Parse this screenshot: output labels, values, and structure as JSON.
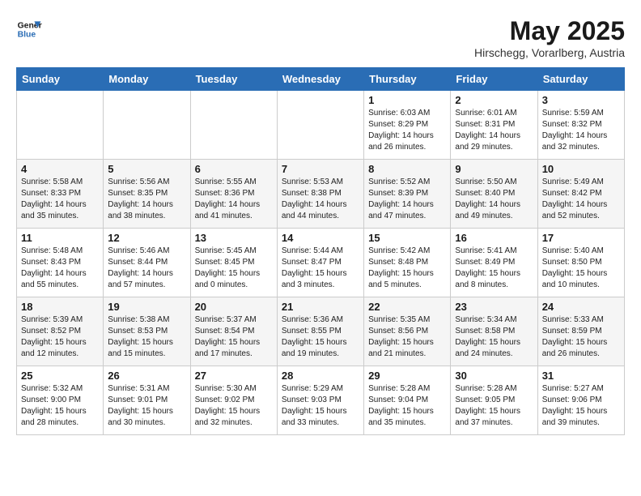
{
  "header": {
    "logo_line1": "General",
    "logo_line2": "Blue",
    "month_year": "May 2025",
    "location": "Hirschegg, Vorarlberg, Austria"
  },
  "days_of_week": [
    "Sunday",
    "Monday",
    "Tuesday",
    "Wednesday",
    "Thursday",
    "Friday",
    "Saturday"
  ],
  "weeks": [
    [
      {
        "day": "",
        "info": ""
      },
      {
        "day": "",
        "info": ""
      },
      {
        "day": "",
        "info": ""
      },
      {
        "day": "",
        "info": ""
      },
      {
        "day": "1",
        "info": "Sunrise: 6:03 AM\nSunset: 8:29 PM\nDaylight: 14 hours\nand 26 minutes."
      },
      {
        "day": "2",
        "info": "Sunrise: 6:01 AM\nSunset: 8:31 PM\nDaylight: 14 hours\nand 29 minutes."
      },
      {
        "day": "3",
        "info": "Sunrise: 5:59 AM\nSunset: 8:32 PM\nDaylight: 14 hours\nand 32 minutes."
      }
    ],
    [
      {
        "day": "4",
        "info": "Sunrise: 5:58 AM\nSunset: 8:33 PM\nDaylight: 14 hours\nand 35 minutes."
      },
      {
        "day": "5",
        "info": "Sunrise: 5:56 AM\nSunset: 8:35 PM\nDaylight: 14 hours\nand 38 minutes."
      },
      {
        "day": "6",
        "info": "Sunrise: 5:55 AM\nSunset: 8:36 PM\nDaylight: 14 hours\nand 41 minutes."
      },
      {
        "day": "7",
        "info": "Sunrise: 5:53 AM\nSunset: 8:38 PM\nDaylight: 14 hours\nand 44 minutes."
      },
      {
        "day": "8",
        "info": "Sunrise: 5:52 AM\nSunset: 8:39 PM\nDaylight: 14 hours\nand 47 minutes."
      },
      {
        "day": "9",
        "info": "Sunrise: 5:50 AM\nSunset: 8:40 PM\nDaylight: 14 hours\nand 49 minutes."
      },
      {
        "day": "10",
        "info": "Sunrise: 5:49 AM\nSunset: 8:42 PM\nDaylight: 14 hours\nand 52 minutes."
      }
    ],
    [
      {
        "day": "11",
        "info": "Sunrise: 5:48 AM\nSunset: 8:43 PM\nDaylight: 14 hours\nand 55 minutes."
      },
      {
        "day": "12",
        "info": "Sunrise: 5:46 AM\nSunset: 8:44 PM\nDaylight: 14 hours\nand 57 minutes."
      },
      {
        "day": "13",
        "info": "Sunrise: 5:45 AM\nSunset: 8:45 PM\nDaylight: 15 hours\nand 0 minutes."
      },
      {
        "day": "14",
        "info": "Sunrise: 5:44 AM\nSunset: 8:47 PM\nDaylight: 15 hours\nand 3 minutes."
      },
      {
        "day": "15",
        "info": "Sunrise: 5:42 AM\nSunset: 8:48 PM\nDaylight: 15 hours\nand 5 minutes."
      },
      {
        "day": "16",
        "info": "Sunrise: 5:41 AM\nSunset: 8:49 PM\nDaylight: 15 hours\nand 8 minutes."
      },
      {
        "day": "17",
        "info": "Sunrise: 5:40 AM\nSunset: 8:50 PM\nDaylight: 15 hours\nand 10 minutes."
      }
    ],
    [
      {
        "day": "18",
        "info": "Sunrise: 5:39 AM\nSunset: 8:52 PM\nDaylight: 15 hours\nand 12 minutes."
      },
      {
        "day": "19",
        "info": "Sunrise: 5:38 AM\nSunset: 8:53 PM\nDaylight: 15 hours\nand 15 minutes."
      },
      {
        "day": "20",
        "info": "Sunrise: 5:37 AM\nSunset: 8:54 PM\nDaylight: 15 hours\nand 17 minutes."
      },
      {
        "day": "21",
        "info": "Sunrise: 5:36 AM\nSunset: 8:55 PM\nDaylight: 15 hours\nand 19 minutes."
      },
      {
        "day": "22",
        "info": "Sunrise: 5:35 AM\nSunset: 8:56 PM\nDaylight: 15 hours\nand 21 minutes."
      },
      {
        "day": "23",
        "info": "Sunrise: 5:34 AM\nSunset: 8:58 PM\nDaylight: 15 hours\nand 24 minutes."
      },
      {
        "day": "24",
        "info": "Sunrise: 5:33 AM\nSunset: 8:59 PM\nDaylight: 15 hours\nand 26 minutes."
      }
    ],
    [
      {
        "day": "25",
        "info": "Sunrise: 5:32 AM\nSunset: 9:00 PM\nDaylight: 15 hours\nand 28 minutes."
      },
      {
        "day": "26",
        "info": "Sunrise: 5:31 AM\nSunset: 9:01 PM\nDaylight: 15 hours\nand 30 minutes."
      },
      {
        "day": "27",
        "info": "Sunrise: 5:30 AM\nSunset: 9:02 PM\nDaylight: 15 hours\nand 32 minutes."
      },
      {
        "day": "28",
        "info": "Sunrise: 5:29 AM\nSunset: 9:03 PM\nDaylight: 15 hours\nand 33 minutes."
      },
      {
        "day": "29",
        "info": "Sunrise: 5:28 AM\nSunset: 9:04 PM\nDaylight: 15 hours\nand 35 minutes."
      },
      {
        "day": "30",
        "info": "Sunrise: 5:28 AM\nSunset: 9:05 PM\nDaylight: 15 hours\nand 37 minutes."
      },
      {
        "day": "31",
        "info": "Sunrise: 5:27 AM\nSunset: 9:06 PM\nDaylight: 15 hours\nand 39 minutes."
      }
    ]
  ]
}
